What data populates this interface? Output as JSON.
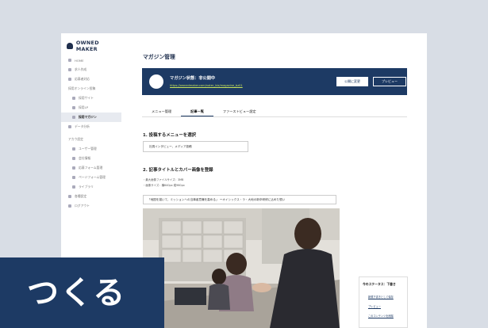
{
  "app": {
    "logo": "OWNED MAKER"
  },
  "sidebar": {
    "items": [
      {
        "label": "HOME"
      },
      {
        "label": "求人作成"
      },
      {
        "label": "応募者対応"
      },
      {
        "label": "採用オンライン投稿"
      },
      {
        "label": "採用サイト"
      },
      {
        "label": "採用LP"
      },
      {
        "label": "採用マガジン"
      },
      {
        "label": "データ分析"
      },
      {
        "label": "アカウ設定"
      },
      {
        "label": "ユーザー管理"
      },
      {
        "label": "会社情報"
      },
      {
        "label": "応募フォーム管理"
      },
      {
        "label": "ページフォーム管理"
      },
      {
        "label": "ライブラリ"
      },
      {
        "label": "各種設定"
      },
      {
        "label": "ログアウト"
      }
    ]
  },
  "main": {
    "title": "マガジン管理",
    "status": {
      "label": "マガジン状態：非公開中",
      "url": "https://ownedmaker.com/noter_biz/magazine_bz01",
      "publish_button": "公開に変更",
      "preview_button": "プレビュー"
    },
    "tabs": [
      {
        "label": "メニュー管理"
      },
      {
        "label": "記事一覧"
      },
      {
        "label": "ファーストビュー設定"
      }
    ],
    "section1": {
      "title": "1. 投稿するメニューを選択",
      "select_value": "社員インタビュー、メディア投稿"
    },
    "section2": {
      "title": "2. 記事タイトルとカバー画像を登録",
      "hint1": "・最大画像ファイルサイズ：3MB",
      "hint2": "・画像サイズ：横640px 縦960px",
      "caption": "「地図を描いて、ミッションへの当事者意識を高める」 ーオイシックス・ラ・大地の新卒研修に込めた想い"
    },
    "right_panel": {
      "title": "今のステータス：下書き",
      "links": [
        "新規下書きとして保存",
        "プレビュー",
        "このコンテンツを削除"
      ]
    }
  },
  "banner": {
    "text": "つくる"
  },
  "colors": {
    "navy": "#1d3a64",
    "background": "#d8dde5",
    "link": "#c8e35a"
  }
}
